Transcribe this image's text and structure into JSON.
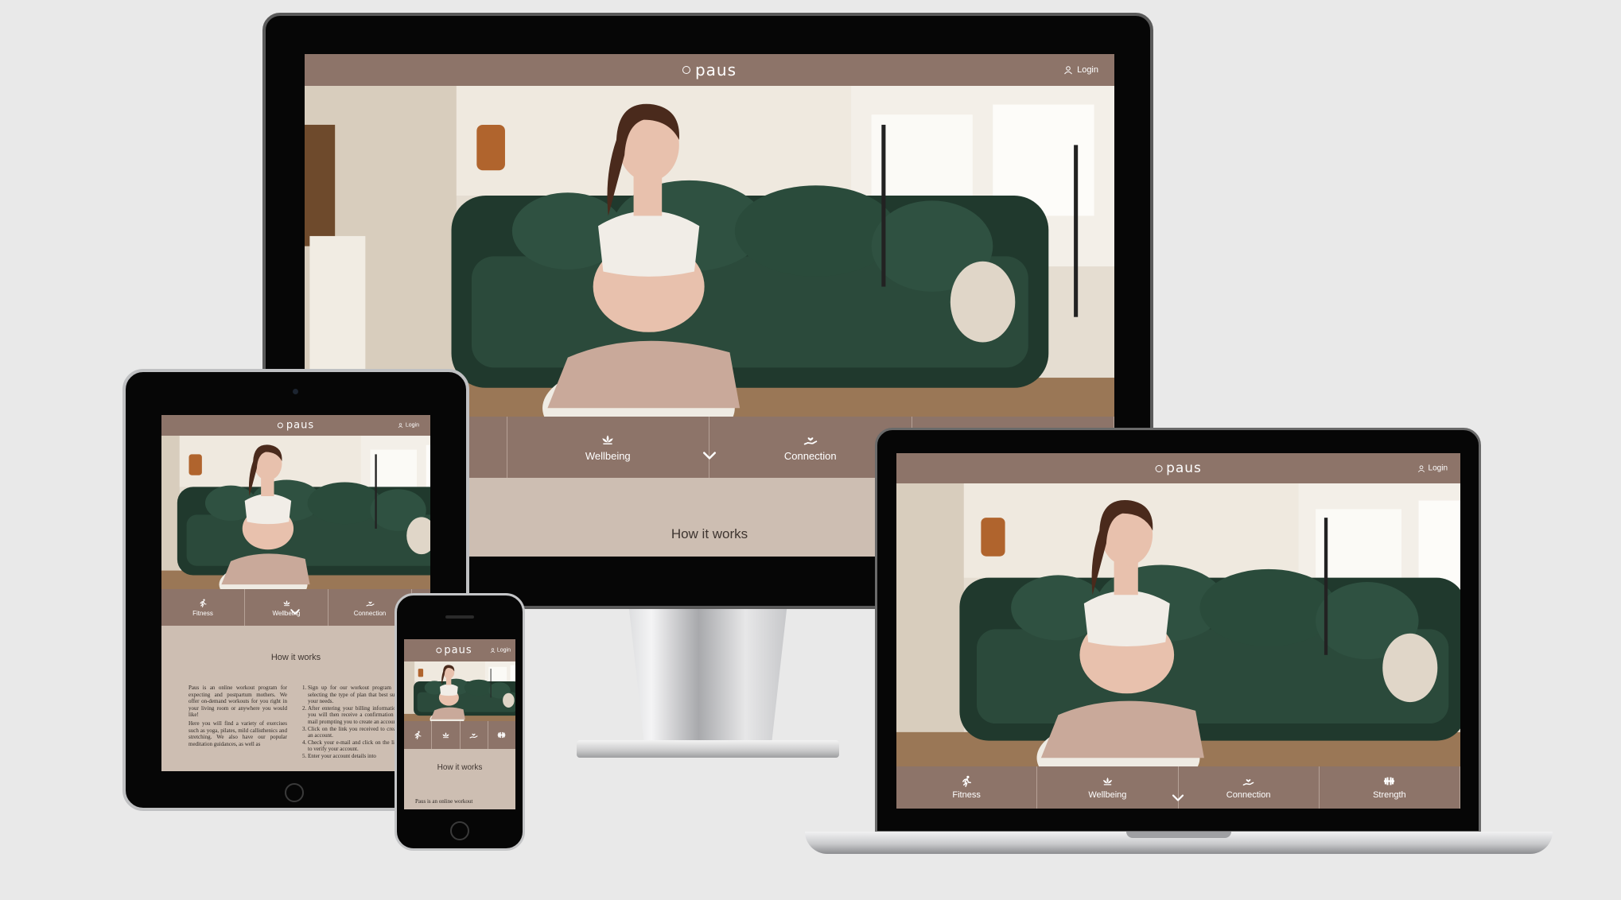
{
  "site": {
    "logo_text": "paus",
    "login_label": "Login",
    "nav": [
      {
        "label": "Fitness",
        "icon": "runner-icon"
      },
      {
        "label": "Wellbeing",
        "icon": "lotus-icon"
      },
      {
        "label": "Connection",
        "icon": "hand-heart-icon"
      },
      {
        "label": "Strength",
        "icon": "dumbbell-icon"
      }
    ],
    "nav_toggle_icon": "chevron-down-icon",
    "how_title": "How it works",
    "left_copy": [
      "Paus is an online workout program for expecting and postpartum mothers. We offer on-demand workouts for you right in your living room or anywhere you would like!",
      "Here you will find a variety of exercises such as yoga, pilates, mild callisthenics and stretching. We also have our popular meditation guidances, as well as"
    ],
    "steps": [
      "Sign up for our workout program by selecting the type of plan that best suits your needs.",
      "After entering your billing information, you will then receive a confirmation e-mail prompting you to create an account.",
      "Click on the link you received to create an account.",
      "Check your e-mail and click on the link to verify your account.",
      "Enter your account details into"
    ],
    "phone_copy": "Paus is an online workout"
  },
  "colors": {
    "brand": "#8d7469",
    "band": "#cdbeb2",
    "background": "#e9e9e9"
  }
}
